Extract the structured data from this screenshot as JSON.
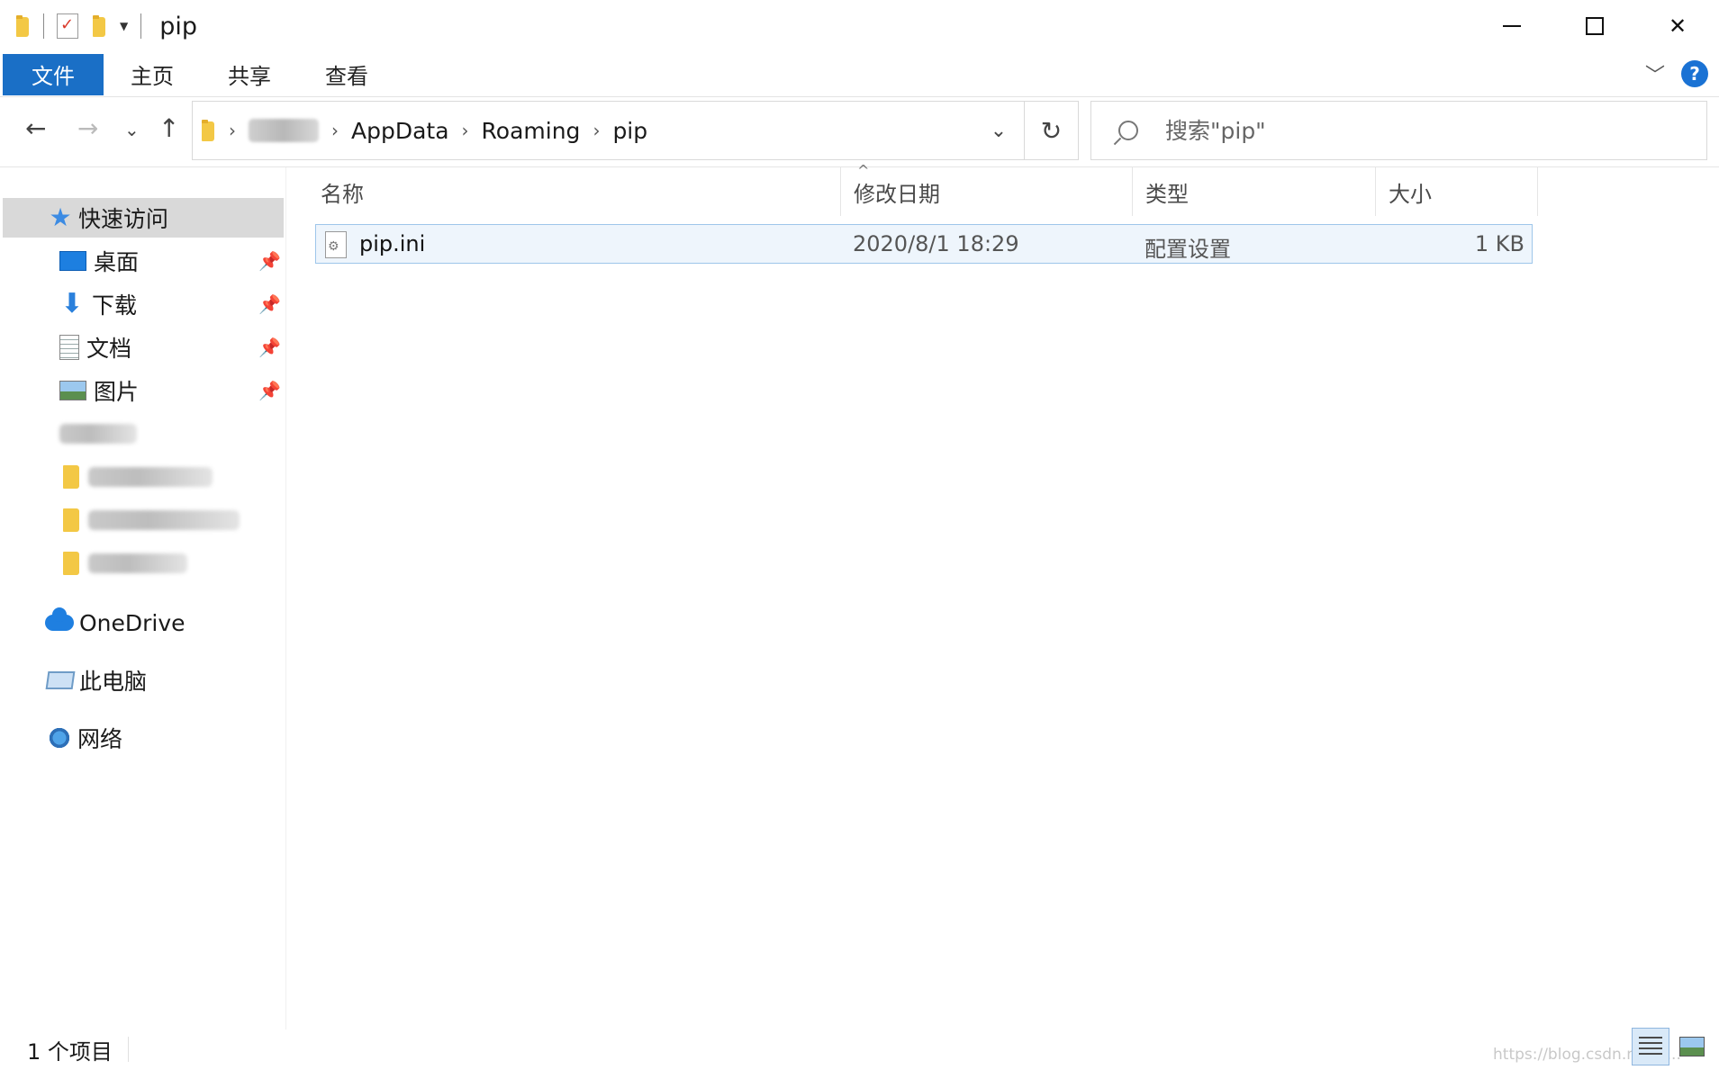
{
  "window": {
    "title": "pip",
    "controls": [
      "minimize",
      "maximize",
      "close"
    ]
  },
  "ribbon": {
    "tabs": [
      "文件",
      "主页",
      "共享",
      "查看"
    ],
    "active_tab_color": "#1a6fc6"
  },
  "navigation": {
    "breadcrumb": [
      "AppData",
      "Roaming",
      "pip"
    ],
    "search_placeholder": "搜索\"pip\""
  },
  "sidebar": {
    "quick_access": "快速访问",
    "pinned": [
      "桌面",
      "下载",
      "文档",
      "图片"
    ],
    "onedrive": "OneDrive",
    "this_pc": "此电脑",
    "network": "网络"
  },
  "columns": {
    "name": "名称",
    "modified": "修改日期",
    "type": "类型",
    "size": "大小"
  },
  "files": [
    {
      "name": "pip.ini",
      "modified": "2020/8/1 18:29",
      "type": "配置设置",
      "size": "1 KB"
    }
  ],
  "status": {
    "item_count": "1 个项目"
  },
  "watermark": "https://blog.csdn.net/q..."
}
